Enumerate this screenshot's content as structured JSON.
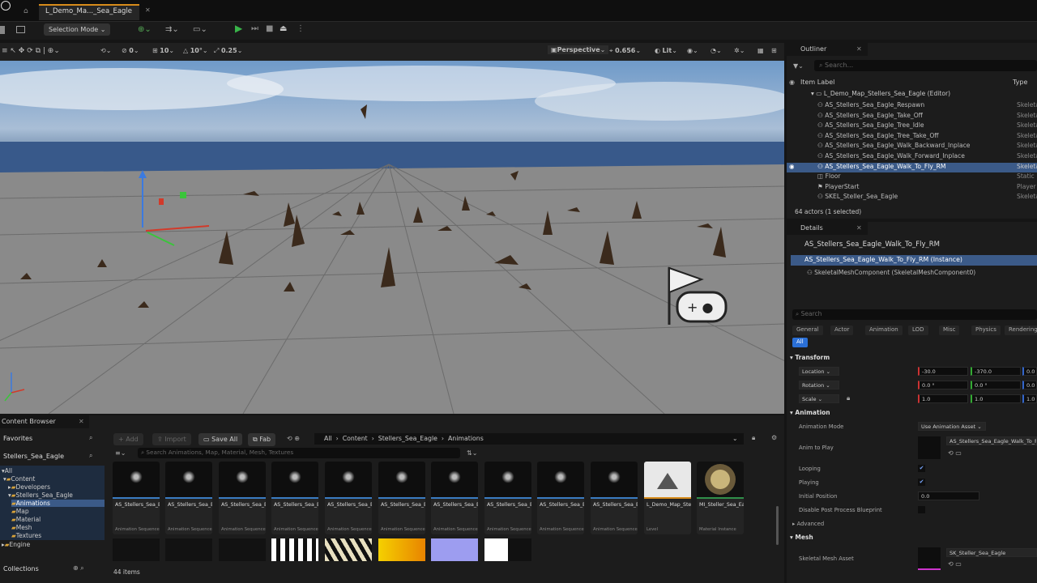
{
  "window": {
    "tab_title": "L_Demo_Ma..._Sea_Eagle"
  },
  "toolbar": {
    "mode": "Selection Mode"
  },
  "viewport_bar": {
    "view": "Perspective",
    "fov": "0.656",
    "lit": "Lit",
    "grid_a": "0",
    "grid_b": "10",
    "rot": "10°",
    "scale": "0.25"
  },
  "outliner": {
    "title": "Outliner",
    "search_placeholder": "Search...",
    "col_label": "Item Label",
    "col_type": "Type",
    "root": "L_Demo_Map_Stellers_Sea_Eagle (Editor)",
    "items": [
      {
        "label": "AS_Stellers_Sea_Eagle_Respawn",
        "type": "Skeleta"
      },
      {
        "label": "AS_Stellers_Sea_Eagle_Take_Off",
        "type": "Skeleta"
      },
      {
        "label": "AS_Stellers_Sea_Eagle_Tree_Idle",
        "type": "Skeleta"
      },
      {
        "label": "AS_Stellers_Sea_Eagle_Tree_Take_Off",
        "type": "Skeleta"
      },
      {
        "label": "AS_Stellers_Sea_Eagle_Walk_Backward_Inplace",
        "type": "Skeleta"
      },
      {
        "label": "AS_Stellers_Sea_Eagle_Walk_Forward_Inplace",
        "type": "Skeleta"
      },
      {
        "label": "AS_Stellers_Sea_Eagle_Walk_To_Fly_RM",
        "type": "Skeleta"
      },
      {
        "label": "Floor",
        "type": "Static"
      },
      {
        "label": "PlayerStart",
        "type": "Player"
      },
      {
        "label": "SKEL_Steller_Sea_Eagle",
        "type": "Skeleta"
      }
    ],
    "status": "64 actors (1 selected)"
  },
  "details": {
    "title": "Details",
    "actor": "AS_Stellers_Sea_Eagle_Walk_To_Fly_RM",
    "instance": "AS_Stellers_Sea_Eagle_Walk_To_Fly_RM (Instance)",
    "component": "SkeletalMeshComponent (SkeletalMeshComponent0)",
    "search_placeholder": "Search",
    "tabs": [
      "General",
      "Actor",
      "Animation",
      "LOD",
      "Misc",
      "Physics",
      "Rendering"
    ],
    "tab_all": "All",
    "transform": "Transform",
    "location": "Location",
    "rotation": "Rotation",
    "scale": "Scale",
    "loc": [
      "-30.0",
      "-370.0",
      "0.0"
    ],
    "rot": [
      "0.0 °",
      "0.0 °",
      "0.0 °"
    ],
    "scl": [
      "1.0",
      "1.0",
      "1.0"
    ],
    "animation": "Animation",
    "anim_mode_label": "Animation Mode",
    "anim_mode": "Use Animation Asset",
    "anim_to_play_label": "Anim to Play",
    "anim_to_play": "AS_Stellers_Sea_Eagle_Walk_To_Fl",
    "looping": "Looping",
    "playing": "Playing",
    "initial_position_label": "Initial Position",
    "initial_position": "0.0",
    "disable_pp": "Disable Post Process Blueprint",
    "advanced": "Advanced",
    "mesh": "Mesh",
    "skel_mesh_label": "Skeletal Mesh Asset",
    "skel_mesh": "SK_Steller_Sea_Eagle"
  },
  "content_browser": {
    "title": "Content Browser",
    "favorites": "Favorites",
    "project": "Stellers_Sea_Eagle",
    "add": "Add",
    "import": "Import",
    "save_all": "Save All",
    "fab": "Fab",
    "breadcrumb": [
      "All",
      "Content",
      "Stellers_Sea_Eagle",
      "Animations"
    ],
    "search_placeholder": "Search Animations, Map, Material, Mesh, Textures",
    "tree": [
      "All",
      "Content",
      "Developers",
      "Stellers_Sea_Eagle",
      "Animations",
      "Map",
      "Material",
      "Mesh",
      "Textures",
      "Engine"
    ],
    "collections": "Collections",
    "count": "44 items",
    "assets": [
      {
        "name": "AS_Stellers_Sea_Eagle_Land",
        "type": "Animation Sequence"
      },
      {
        "name": "AS_Stellers_Sea_Eagle_Land_on_Tree",
        "type": "Animation Sequence"
      },
      {
        "name": "AS_Stellers_Sea_Eagle_Reborn",
        "type": "Animation Sequence"
      },
      {
        "name": "AS_Stellers_Sea_Eagle_Respawn",
        "type": "Animation Sequence"
      },
      {
        "name": "AS_Stellers_Sea_Eagle_Take_Off",
        "type": "Animation Sequence"
      },
      {
        "name": "AS_Stellers_Sea_Eagle_Tree_Idle",
        "type": "Animation Sequence"
      },
      {
        "name": "AS_Stellers_Sea_Eagle_Tree_Take_Off",
        "type": "Animation Sequence"
      },
      {
        "name": "AS_Stellers_Sea_Eagle_Walk_Backward_...",
        "type": "Animation Sequence"
      },
      {
        "name": "AS_Stellers_Sea_Eagle_Walk_Forward_...",
        "type": "Animation Sequence"
      },
      {
        "name": "AS_Stellers_Sea_Eagle_Walk_To_Fly_RM",
        "type": "Animation Sequence"
      },
      {
        "name": "L_Demo_Map_Stellers_Sea_Eagle",
        "type": "Level"
      },
      {
        "name": "MI_Steller_Sea_Eagle",
        "type": "Material Instance"
      }
    ]
  }
}
